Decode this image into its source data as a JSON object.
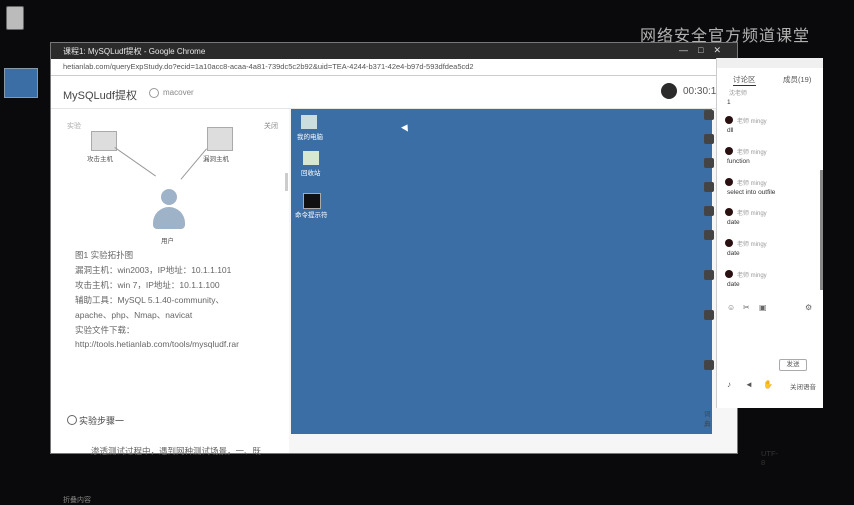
{
  "host": {
    "watermark": "网络安全官方频道课堂"
  },
  "browser": {
    "tab_title": "课程1: MySQLudf提权 - Google Chrome",
    "url": "hetianlab.com/queryExpStudy.do?ecid=1a10acc8-acaa-4a81-739dc5c2b92&uid=TEA-4244-b371-42e4-b97d-593dfdea5cd2",
    "window_controls": "—□✕"
  },
  "app": {
    "title": "MySQLudf提权",
    "user_name": "macover",
    "timer": "00:30:1"
  },
  "left_panel": {
    "top_caption": "实验",
    "close_label": "关闭",
    "diagram_labels": [
      "攻击主机",
      "漏洞主机",
      "用户"
    ],
    "info_lines": [
      "图1 实验拓扑图",
      "漏洞主机：win2003，IP地址：10.1.1.101",
      "攻击主机：win 7，IP地址：10.1.1.100",
      "辅助工具：MySQL 5.1.40-community、",
      "apache、php、Nmap、navicat",
      "实验文件下载：",
      "http://tools.hetianlab.com/tools/mysqludf.rar"
    ],
    "step_title": "实验步骤一",
    "step_desc": "渗透测试过程中，遇到网种测试场景，一、既",
    "collapse_label": "折叠内容"
  },
  "vm": {
    "icons": [
      {
        "name": "我的电脑",
        "icon": "computer-icon"
      },
      {
        "name": "回收站",
        "icon": "recycle-bin-icon"
      },
      {
        "name": "命令提示符",
        "icon": "cmd-icon"
      }
    ]
  },
  "side_toolbar": {
    "items": [
      "",
      "",
      "",
      "",
      "",
      "",
      "",
      "",
      ""
    ],
    "bottom_label": "词典",
    "encoding": "UTF-8"
  },
  "chat": {
    "tabs": [
      "讨论区",
      "成员(19)"
    ],
    "first": {
      "name": "沈老师",
      "text": "1"
    },
    "messages": [
      {
        "name": "老师 mingy",
        "text": "dll"
      },
      {
        "name": "老师 mingy",
        "text": "function"
      },
      {
        "name": "老师 mingy",
        "text": "select into outfile"
      },
      {
        "name": "老师 mingy",
        "text": "date"
      },
      {
        "name": "老师 mingy",
        "text": "date"
      },
      {
        "name": "老师 mingy",
        "text": "date"
      }
    ],
    "send_label": "发送",
    "sound_label": "关闭语音"
  },
  "colors": {
    "vm_desktop": "#3b6ea5",
    "titlebar": "#2b2b2b"
  }
}
